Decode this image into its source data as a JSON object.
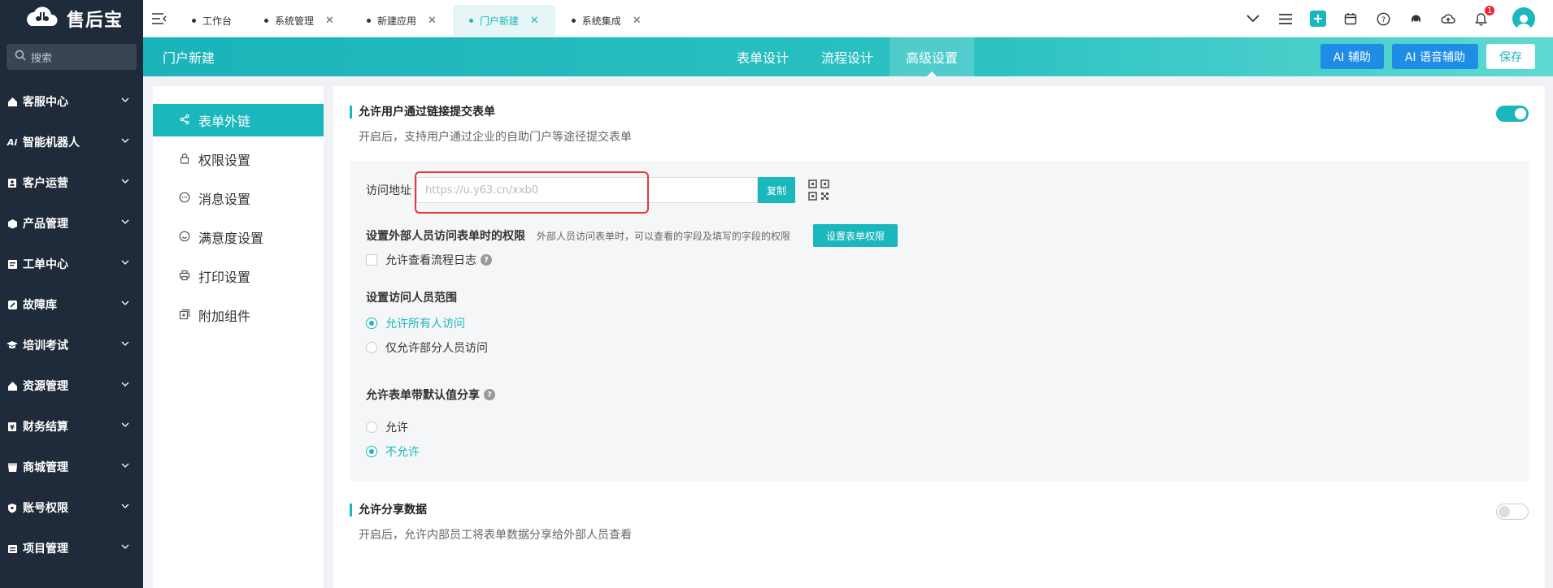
{
  "brand": {
    "name": "售后宝",
    "accent": "#1ab7bd",
    "sidebar_bg": "#1f2b3a"
  },
  "sidebar": {
    "search_placeholder": "搜索",
    "items": [
      {
        "label": "客服中心",
        "icon": "home-icon"
      },
      {
        "label": "智能机器人",
        "icon": "ai-icon"
      },
      {
        "label": "客户运营",
        "icon": "contact-card-icon"
      },
      {
        "label": "产品管理",
        "icon": "box-icon"
      },
      {
        "label": "工单中心",
        "icon": "ticket-icon"
      },
      {
        "label": "故障库",
        "icon": "wrench-icon"
      },
      {
        "label": "培训考试",
        "icon": "graduation-cap-icon"
      },
      {
        "label": "资源管理",
        "icon": "home-icon"
      },
      {
        "label": "财务结算",
        "icon": "finance-icon"
      },
      {
        "label": "商城管理",
        "icon": "shop-icon"
      },
      {
        "label": "账号权限",
        "icon": "shield-icon"
      },
      {
        "label": "项目管理",
        "icon": "project-icon"
      }
    ]
  },
  "topbar": {
    "tabs": [
      {
        "label": "工作台",
        "closable": false,
        "active": false
      },
      {
        "label": "系统管理",
        "closable": true,
        "active": false
      },
      {
        "label": "新建应用",
        "closable": true,
        "active": false
      },
      {
        "label": "门户新建",
        "closable": true,
        "active": true
      },
      {
        "label": "系统集成",
        "closable": true,
        "active": false
      }
    ],
    "notification_count": "1"
  },
  "header": {
    "title": "门户新建",
    "steps": [
      "表单设计",
      "流程设计",
      "高级设置"
    ],
    "ai_assist": "AI 辅助",
    "ai_voice": "AI 语音辅助",
    "save": "保存"
  },
  "settings_nav": [
    {
      "label": "表单外链",
      "icon": "share-icon",
      "active": true
    },
    {
      "label": "权限设置",
      "icon": "lock-icon",
      "active": false
    },
    {
      "label": "消息设置",
      "icon": "message-icon",
      "active": false
    },
    {
      "label": "满意度设置",
      "icon": "smile-icon",
      "active": false
    },
    {
      "label": "打印设置",
      "icon": "printer-icon",
      "active": false
    },
    {
      "label": "附加组件",
      "icon": "addon-icon",
      "active": false
    }
  ],
  "section1": {
    "title": "允许用户通过链接提交表单",
    "desc": "开启后，支持用户通过企业的自助门户等途径提交表单",
    "enabled": true
  },
  "access": {
    "label": "访问地址",
    "url_placeholder": "https://u.y63.cn/xxb0",
    "copy": "复制",
    "perm_label": "设置外部人员访问表单时的权限",
    "perm_hint": "外部人员访问表单时，可以查看的字段及填写的字段的权限",
    "perm_button": "设置表单权限",
    "log_checkbox": "允许查看流程日志",
    "scope_label": "设置访问人员范围",
    "scope_options": [
      "允许所有人访问",
      "仅允许部分人员访问"
    ],
    "scope_selected": 0,
    "share_label": "允许表单带默认值分享",
    "share_options": [
      "允许",
      "不允许"
    ],
    "share_selected": 1
  },
  "section2": {
    "title": "允许分享数据",
    "desc": "开启后，允许内部员工将表单数据分享给外部人员查看",
    "enabled": false
  }
}
